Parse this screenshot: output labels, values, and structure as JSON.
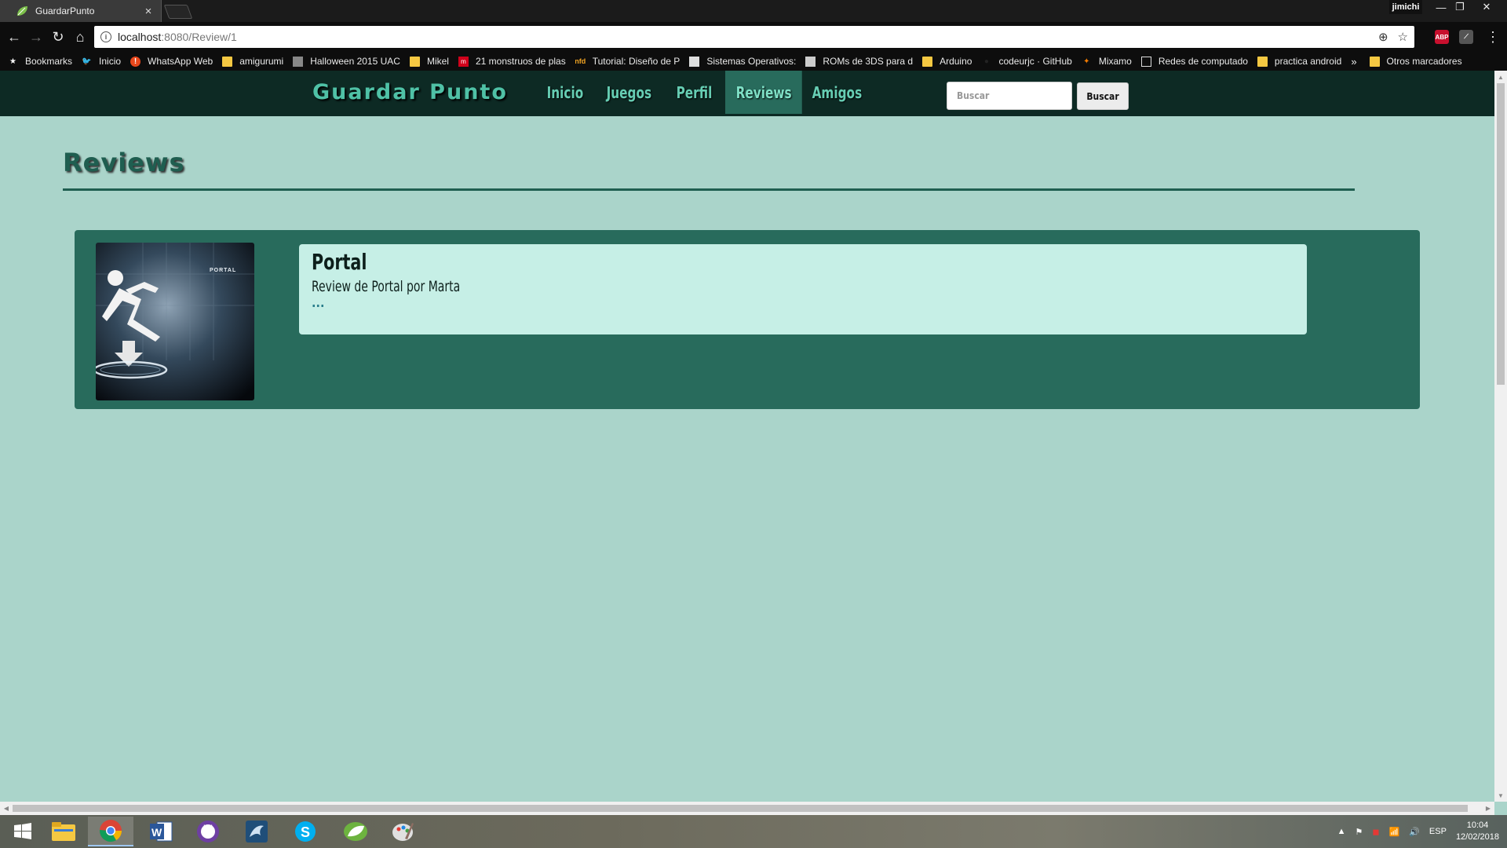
{
  "browser": {
    "tab_title": "GuardarPunto",
    "profile_name": "jimichi",
    "url_host": "localhost",
    "url_path": ":8080/Review/1",
    "window_controls": {
      "minimize": "—",
      "restore": "❐",
      "close": "✕"
    }
  },
  "bookmarks": {
    "items": [
      {
        "label": "Bookmarks",
        "icon": "star-icon"
      },
      {
        "label": "Inicio",
        "icon": "twitter-icon"
      },
      {
        "label": "WhatsApp Web",
        "icon": "alert-icon"
      },
      {
        "label": "amigurumi",
        "icon": "folder-icon"
      },
      {
        "label": "Halloween 2015 UAC",
        "icon": "page-icon"
      },
      {
        "label": "Mikel",
        "icon": "folder-icon"
      },
      {
        "label": "21 monstruos de plas",
        "icon": "site-icon"
      },
      {
        "label": "Tutorial: Diseño de P",
        "icon": "site-icon"
      },
      {
        "label": "Sistemas Operativos:",
        "icon": "site-icon"
      },
      {
        "label": "ROMs de 3DS para d",
        "icon": "site-icon"
      },
      {
        "label": "Arduino",
        "icon": "folder-icon"
      },
      {
        "label": "codeurjc · GitHub",
        "icon": "github-icon"
      },
      {
        "label": "Mixamo",
        "icon": "site-icon"
      },
      {
        "label": "Redes de computado",
        "icon": "page-icon"
      },
      {
        "label": "practica android",
        "icon": "folder-icon"
      }
    ],
    "more": "»",
    "other_label": "Otros marcadores"
  },
  "site": {
    "brand": "Guardar Punto",
    "nav": [
      {
        "label": "Inicio",
        "active": false
      },
      {
        "label": "Juegos",
        "active": false
      },
      {
        "label": "Perfil",
        "active": false
      },
      {
        "label": "Reviews",
        "active": true
      },
      {
        "label": "Amigos",
        "active": false
      }
    ],
    "search_placeholder": "Buscar",
    "search_button": "Buscar"
  },
  "page": {
    "heading": "Reviews",
    "reviews": [
      {
        "title": "Portal",
        "subtitle": "Review de Portal por Marta",
        "more_link": "...",
        "cover_logo": "PORTAL"
      }
    ]
  },
  "taskbar": {
    "language": "ESP",
    "time": "10:04",
    "date": "12/02/2018"
  },
  "colors": {
    "page_bg": "#aad4ca",
    "navbar_bg": "#0d2a24",
    "accent": "#4fc1a6",
    "card_bg": "#286b5c",
    "card_body_bg": "#c6efe6"
  }
}
